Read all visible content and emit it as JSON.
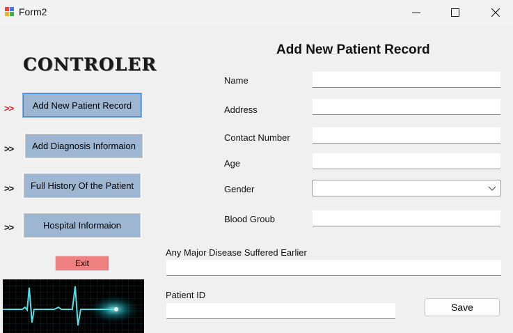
{
  "window": {
    "title": "Form2",
    "icon": "winforms-app-icon",
    "controls": [
      "minimize-icon",
      "maximize-icon",
      "close-icon"
    ]
  },
  "sidebar": {
    "title": "CONTROLER",
    "arrow": ">>",
    "items": [
      {
        "label": "Add New Patient Record",
        "active": true
      },
      {
        "label": "Add Diagnosis Informaion",
        "active": false
      },
      {
        "label": "Full History Of the Patient",
        "active": false
      },
      {
        "label": "Hospital Informaion",
        "active": false
      }
    ],
    "exit_label": "Exit",
    "image": "ecg-heartbeat-image"
  },
  "form": {
    "title": "Add New Patient Record",
    "fields": {
      "name": {
        "label": "Name",
        "value": ""
      },
      "address": {
        "label": "Address",
        "value": ""
      },
      "contact": {
        "label": "Contact Number",
        "value": ""
      },
      "age": {
        "label": "Age",
        "value": ""
      },
      "gender": {
        "label": "Gender",
        "value": ""
      },
      "blood_group": {
        "label": "Blood Groub",
        "value": ""
      },
      "major_disease": {
        "label": "Any Major Disease Suffered Earlier",
        "value": ""
      },
      "patient_id": {
        "label": "Patient ID",
        "value": ""
      }
    },
    "save_label": "Save"
  },
  "colors": {
    "nav_button": "#9db6d2",
    "active_arrow": "#e02020",
    "exit_button": "#ef8080",
    "ecg_line": "#4fe0e8"
  }
}
